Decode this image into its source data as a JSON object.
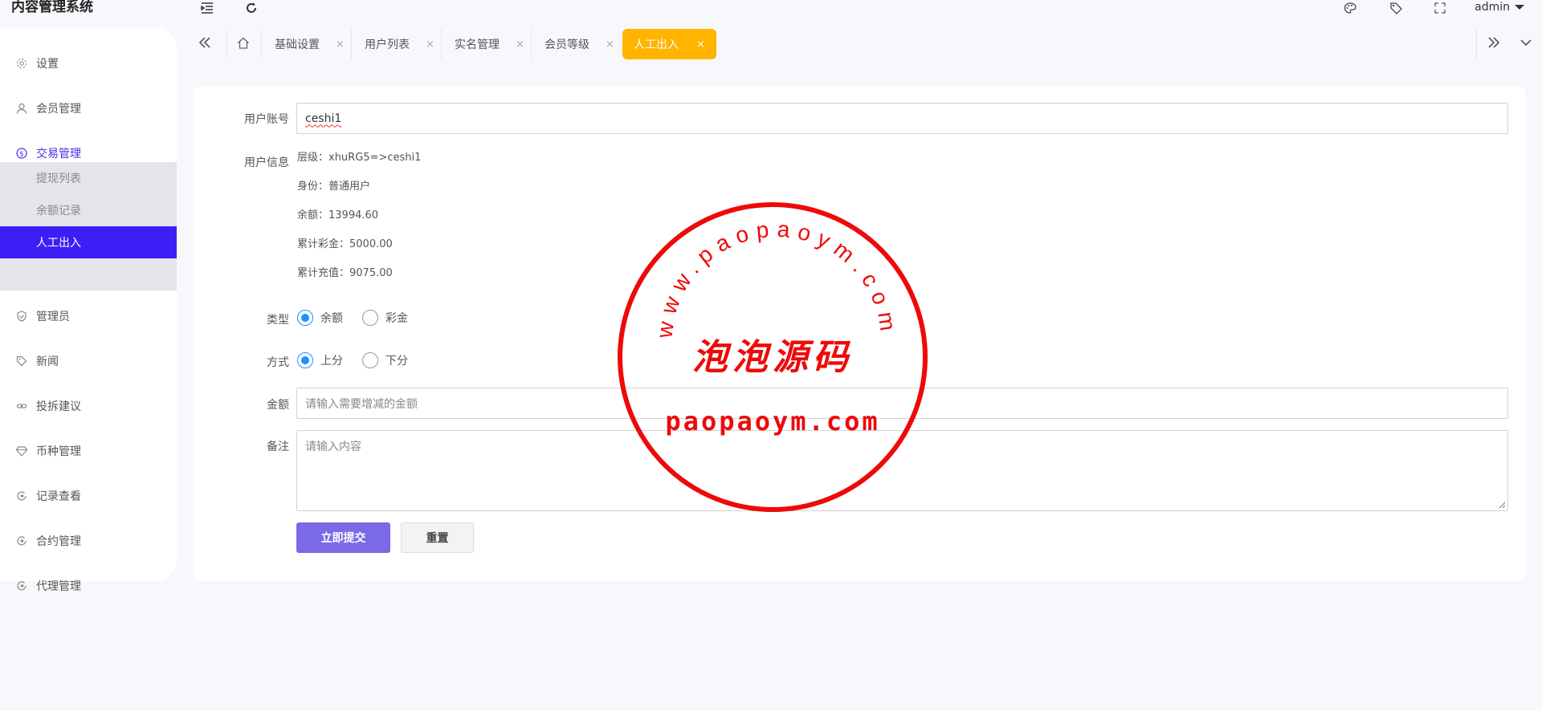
{
  "app_title": "内容管理系统",
  "user_menu": {
    "name": "admin"
  },
  "sidebar": {
    "items": [
      {
        "label": "设置",
        "icon": "gear-icon"
      },
      {
        "label": "会员管理",
        "icon": "user-icon"
      },
      {
        "label": "交易管理",
        "icon": "dollar-icon"
      },
      {
        "label": "管理员",
        "icon": "shield-icon"
      },
      {
        "label": "新闻",
        "icon": "tag-icon"
      },
      {
        "label": "投拆建议",
        "icon": "link-icon"
      },
      {
        "label": "币种管理",
        "icon": "diamond-icon"
      },
      {
        "label": "记录查看",
        "icon": "circle-arrow-icon"
      },
      {
        "label": "合约管理",
        "icon": "circle-arrow-icon"
      },
      {
        "label": "代理管理",
        "icon": "circle-arrow-icon"
      }
    ],
    "submenu": [
      {
        "label": "提现列表"
      },
      {
        "label": "余额记录"
      },
      {
        "label": "人工出入"
      }
    ]
  },
  "tabs": [
    {
      "label": "基础设置"
    },
    {
      "label": "用户列表"
    },
    {
      "label": "实名管理"
    },
    {
      "label": "会员等级"
    },
    {
      "label": "人工出入"
    }
  ],
  "tab_close_glyph": "×",
  "form": {
    "account_label": "用户账号",
    "account_value": "ceshi1",
    "info_label": "用户信息",
    "info_lines": [
      "层级：xhuRG5=>ceshi1",
      "身份：普通用户",
      "余额：13994.60",
      "累计彩金：5000.00",
      "累计充值：9075.00"
    ],
    "type_label": "类型",
    "type_options": [
      "余额",
      "彩金"
    ],
    "method_label": "方式",
    "method_options": [
      "上分",
      "下分"
    ],
    "amount_label": "金额",
    "amount_placeholder": "请输入需要增减的金额",
    "note_label": "备注",
    "note_placeholder": "请输入内容",
    "submit_label": "立即提交",
    "reset_label": "重置"
  },
  "watermark": {
    "arc_text": "www.paopaoym.com",
    "center_text": "泡泡源码",
    "bottom_text": "paopaoym.com",
    "color": "#ee0a0a"
  }
}
